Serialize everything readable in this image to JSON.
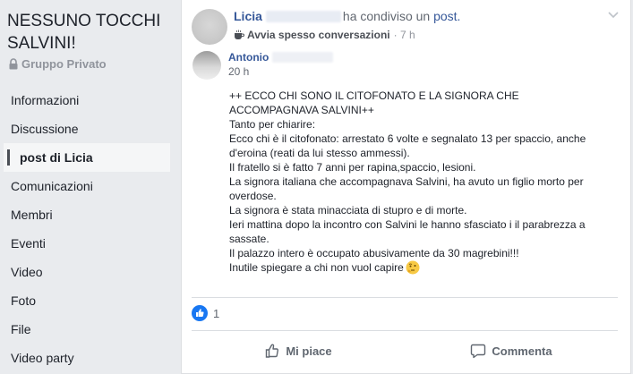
{
  "group": {
    "name": "NESSUNO TOCCHI SALVINI!",
    "privacy": "Gruppo Privato"
  },
  "nav": {
    "items": [
      {
        "label": "Informazioni"
      },
      {
        "label": "Discussione"
      },
      {
        "label": "post di Licia"
      },
      {
        "label": "Comunicazioni"
      },
      {
        "label": "Membri"
      },
      {
        "label": "Eventi"
      },
      {
        "label": "Video"
      },
      {
        "label": "Foto"
      },
      {
        "label": "File"
      },
      {
        "label": "Video party"
      }
    ],
    "active_label": "post di Licia"
  },
  "post": {
    "author": "Licia",
    "shared_text": "ha condiviso un",
    "shared_link": "post.",
    "badge": "Avvia spesso conversazioni",
    "time": "· 7 h",
    "original_author": "Antonio",
    "original_time": "20 h",
    "body": [
      "++ ECCO CHI SONO IL CITOFONATO E LA SIGNORA CHE ACCOMPAGNAVA SALVINI++",
      "Tanto per chiarire:",
      "Ecco chi è il citofonato: arrestato 6 volte e segnalato 13 per spaccio, anche d'eroina (reati da lui stesso ammessi).",
      "Il fratello si è fatto 7 anni per rapina,spaccio, lesioni.",
      "La signora italiana che accompagnava Salvini, ha avuto un figlio morto per overdose.",
      "La signora è stata minacciata di stupro e di morte.",
      "Ieri mattina dopo la incontro con Salvini le hanno sfasciato i il parabrezza a sassate.",
      "Il palazzo intero è occupato abusivamente da 30 magrebini!!!",
      "Inutile spiegare a chi non vuol capire"
    ],
    "reaction_count": "1",
    "like_label": "Mi piace",
    "comment_label": "Commenta"
  },
  "icons": {
    "lock": "lock-icon",
    "coffee": "coffee-cup-icon",
    "chevron": "chevron-down-icon",
    "like_reaction": "like-reaction-icon",
    "thinking_emoji": "thinking-face-emoji",
    "thumb": "thumbs-up-icon",
    "comment": "comment-bubble-icon"
  },
  "colors": {
    "link": "#365899",
    "like_blue": "#1877f2",
    "muted": "#616770"
  }
}
